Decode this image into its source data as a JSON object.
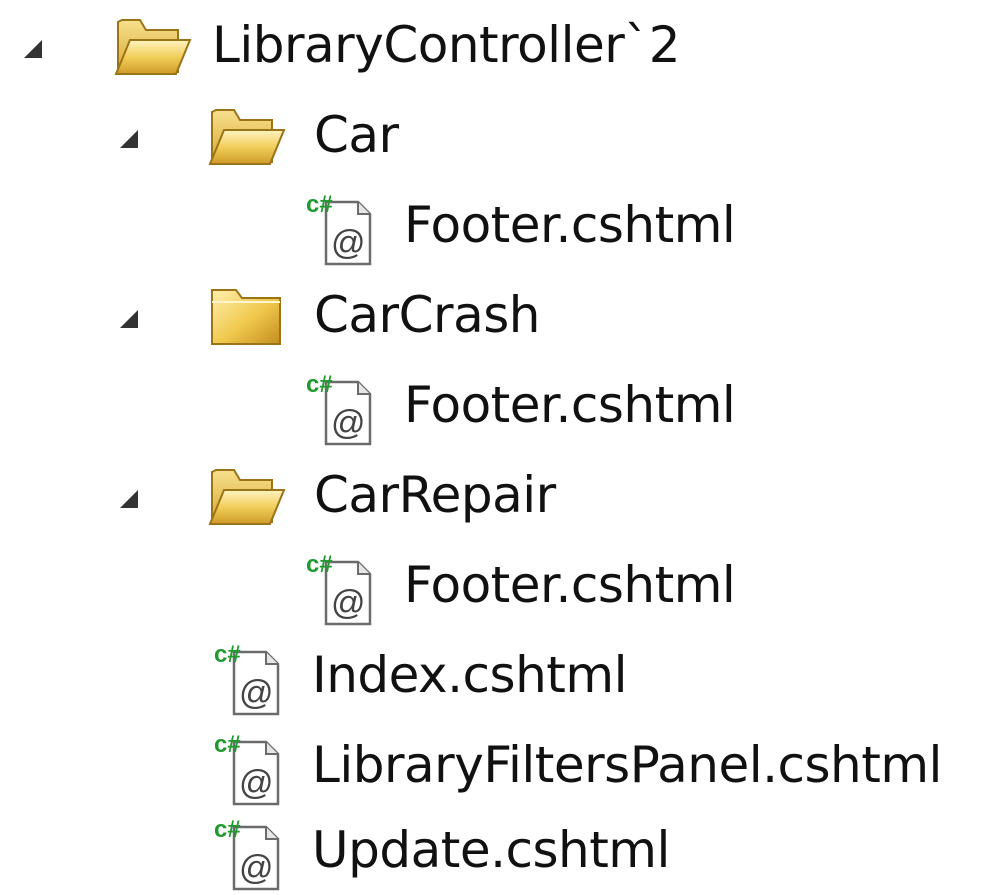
{
  "tree": {
    "root": {
      "label": "LibraryController`2",
      "expanded": true,
      "icon": "open-folder-icon",
      "children": [
        {
          "label": "Car",
          "expanded": true,
          "icon": "open-folder-icon",
          "children": [
            {
              "label": "Footer.cshtml",
              "icon": "cshtml-file-icon"
            }
          ]
        },
        {
          "label": "CarCrash",
          "expanded": true,
          "icon": "closed-folder-icon",
          "children": [
            {
              "label": "Footer.cshtml",
              "icon": "cshtml-file-icon"
            }
          ]
        },
        {
          "label": "CarRepair",
          "expanded": true,
          "icon": "open-folder-icon",
          "children": [
            {
              "label": "Footer.cshtml",
              "icon": "cshtml-file-icon"
            }
          ]
        },
        {
          "label": "Index.cshtml",
          "icon": "cshtml-file-icon"
        },
        {
          "label": "LibraryFiltersPanel.cshtml",
          "icon": "cshtml-file-icon"
        },
        {
          "label": "Update.cshtml",
          "icon": "cshtml-file-icon"
        }
      ]
    }
  },
  "icon_text": {
    "csharp_mark": "c#",
    "at_mark": "@"
  },
  "colors": {
    "folder_yellow": "#f2cf5a",
    "folder_dark": "#c99a2a",
    "csharp_green": "#1f9a2e",
    "file_border": "#6b6b6b",
    "expander": "#333333"
  }
}
